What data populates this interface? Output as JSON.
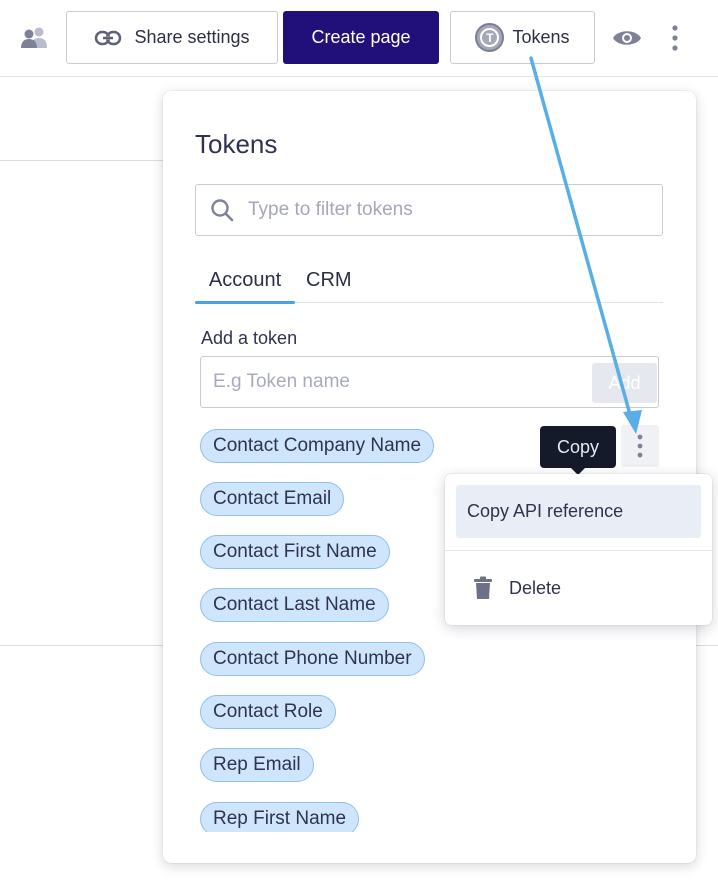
{
  "toolbar": {
    "share_label": "Share settings",
    "create_label": "Create page",
    "tokens_label": "Tokens",
    "tokens_badge": "T",
    "icons": [
      "people-icon",
      "link-icon",
      "eye-icon",
      "kebab-icon"
    ]
  },
  "panel": {
    "title": "Tokens",
    "search_placeholder": "Type to filter tokens",
    "tabs": [
      {
        "label": "Account",
        "active": true
      },
      {
        "label": "CRM",
        "active": false
      }
    ],
    "add_label": "Add a token",
    "add_placeholder": "E.g Token name",
    "add_button": "Add",
    "tokens": [
      "Contact Company Name",
      "Contact Email",
      "Contact First Name",
      "Contact Last Name",
      "Contact Phone Number",
      "Contact Role",
      "Rep Email",
      "Rep First Name"
    ]
  },
  "tooltip": "Copy",
  "menu": {
    "copy_label": "Copy API reference",
    "delete_label": "Delete"
  },
  "colors": {
    "primary": "#22107a",
    "chip_bg": "#cfe5fb",
    "chip_border": "#8fc0ec",
    "tab_accent": "#4aa3e6",
    "annotation_arrow": "#5aaee8"
  }
}
